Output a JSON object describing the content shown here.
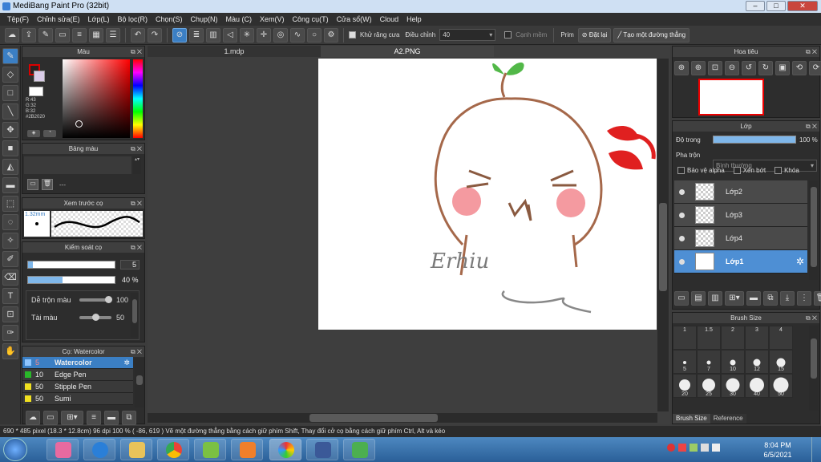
{
  "window": {
    "title": "MediBang Paint Pro (32bit)",
    "min": "–",
    "max": "□",
    "close": "✕"
  },
  "menu": [
    "Tệp(F)",
    "Chỉnh sửa(E)",
    "Lớp(L)",
    "Bộ lọc(R)",
    "Chọn(S)",
    "Chụp(N)",
    "Màu (C)",
    "Xem(V)",
    "Công cụ(T)",
    "Cửa sổ(W)",
    "Cloud",
    "Help"
  ],
  "toolbar": {
    "antialias_label": "Khử răng cưa",
    "adjust_label": "Điều chỉnh",
    "adjust_value": "40",
    "edge_label": "Cạnh mềm",
    "prim_label": "Prim",
    "off_label": "Đặt lại",
    "line_label": "Tạo một đường thẳng"
  },
  "color_panel": {
    "title": "Màu",
    "r": "R:43",
    "g": "G:32",
    "b": "B:32",
    "hex": "#2B2020",
    "fg": "#2b2020",
    "bg": "#ffffff"
  },
  "palette_panel": {
    "title": "Bảng màu",
    "dash": "---"
  },
  "preview_panel": {
    "title": "Xem trước cọ",
    "size": "1.32mm"
  },
  "brush_control": {
    "title": "Kiểm soát cọ",
    "size": "5",
    "opacity": "40 %",
    "opacity_level": 0.4,
    "blend_label": "Dễ trộn màu",
    "blend_value": "100",
    "amount_label": "Tài màu",
    "amount_value": "50"
  },
  "brush_list": {
    "title": "Cọ: Watercolor",
    "items": [
      {
        "size": "5",
        "name": "Watercolor",
        "color": "#8ec5ff"
      },
      {
        "size": "10",
        "name": "Edge Pen",
        "color": "#29b829"
      },
      {
        "size": "50",
        "name": "Stipple Pen",
        "color": "#f0e020"
      },
      {
        "size": "50",
        "name": "Sumi",
        "color": "#f0e020"
      }
    ]
  },
  "tabs": [
    "1.mdp",
    "A2.PNG"
  ],
  "canvas": {
    "signature": "Erhiu"
  },
  "navigator": {
    "title": "Hoa tiêu"
  },
  "layers": {
    "title": "Lớp",
    "opacity_label": "Độ trong",
    "opacity_value": "100 %",
    "blend_label": "Pha trộn",
    "blend_value": "Bình thường",
    "protect_alpha": "Bảo vệ alpha",
    "clipping": "Xén bớt",
    "lock": "Khóa",
    "items": [
      "Lớp2",
      "Lớp3",
      "Lớp4",
      "Lớp1"
    ]
  },
  "brush_size": {
    "title": "Brush Size",
    "sizes": [
      "1",
      "1.5",
      "2",
      "3",
      "4",
      "5",
      "7",
      "10",
      "12",
      "15",
      "20",
      "25",
      "30",
      "40",
      "50"
    ],
    "tabs": [
      "Brush Size",
      "Reference"
    ]
  },
  "status": {
    "text": "690 * 485 pixel   (18.3 * 12.8cm)   96 dpi   100 %   ( -86, 619 )   Vẽ một đường thẳng bằng cách giữ phím Shift, Thay đổi cở cọ bằng cách giữ phím Ctrl, Alt và kéo"
  },
  "taskbar": {
    "time": "8:04 PM",
    "date": "6/5/2021"
  }
}
